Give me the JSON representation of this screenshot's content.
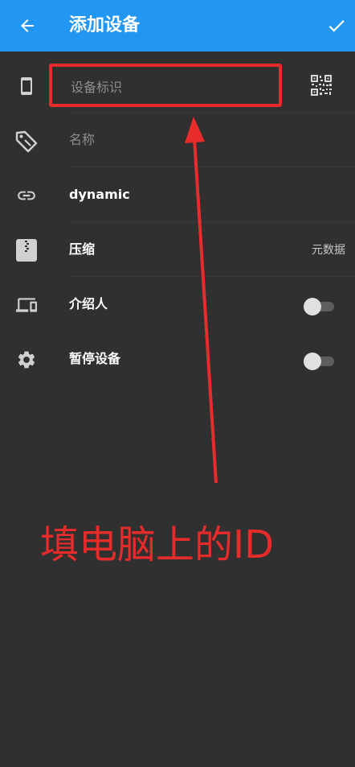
{
  "header": {
    "title": "添加设备",
    "back_icon": "arrow-back-icon",
    "confirm_icon": "check-icon",
    "background_color": "#2196F3"
  },
  "form": {
    "device_id": {
      "placeholder": "设备标识",
      "value": "",
      "icon": "phone-icon",
      "action_icon": "qr-code-icon"
    },
    "name": {
      "label": "名称",
      "icon": "tag-icon"
    },
    "address": {
      "label": "dynamic",
      "icon": "link-icon"
    },
    "compression": {
      "label": "压缩",
      "value": "元数据",
      "icon": "zip-icon"
    },
    "introducer": {
      "label": "介绍人",
      "icon": "devices-icon",
      "enabled": false
    },
    "pause": {
      "label": "暂停设备",
      "icon": "gear-icon",
      "enabled": false
    }
  },
  "annotation": {
    "text": "填电脑上的ID",
    "color": "#e82c2c"
  }
}
